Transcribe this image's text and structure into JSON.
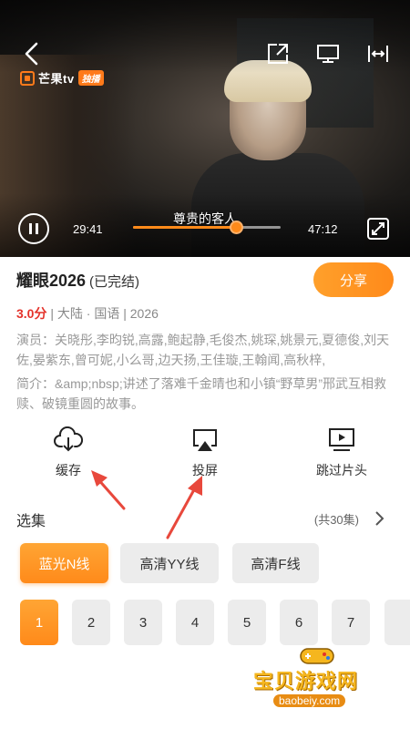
{
  "player": {
    "logo_text": "芒果tv",
    "logo_badge": "独播",
    "subtitle": "尊贵的客人",
    "current_time": "29:41",
    "total_time": "47:12",
    "progress_fraction": 0.7,
    "accent": "#ff8a1a"
  },
  "show": {
    "title": "耀眼2026",
    "status": "(已完结)",
    "share_label": "分享",
    "score": "3.0分",
    "meta_rest": " | 大陆 · 国语 | 2026",
    "cast": "演员：关晓彤,李昀锐,高露,鲍起静,毛俊杰,姚琛,姚景元,夏德俊,刘天佐,晏紫东,曾可妮,小么哥,边天扬,王佳璇,王翰闻,高秋梓,",
    "intro": "简介：&amp;nbsp;讲述了落难千金晴也和小镇“野草男”邢武互相救赎、破镜重圆的故事。"
  },
  "actions": [
    {
      "label": "缓存",
      "icon": "download-cloud-icon"
    },
    {
      "label": "投屏",
      "icon": "cast-screen-icon"
    },
    {
      "label": "跳过片头",
      "icon": "skip-intro-icon"
    }
  ],
  "episodes": {
    "title": "选集",
    "count": "(共30集)",
    "lines": [
      "蓝光N线",
      "高清YY线",
      "高清F线"
    ],
    "selected_line": 0,
    "items": [
      "1",
      "2",
      "3",
      "4",
      "5",
      "6",
      "7"
    ],
    "selected_episode": 0
  },
  "watermark": {
    "text": "宝贝游戏网",
    "url": "baobeiy.com"
  }
}
